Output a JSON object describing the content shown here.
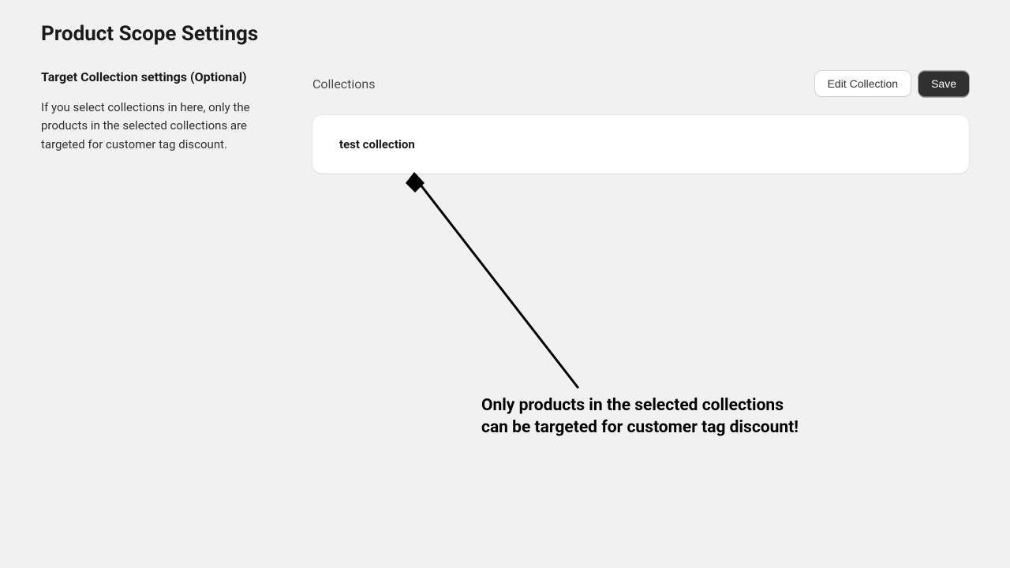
{
  "page": {
    "title": "Product Scope Settings"
  },
  "sidebar": {
    "section_title": "Target Collection settings (Optional)",
    "section_desc": "If you select collections in here, only the products in the selected collections are targeted for customer tag discount."
  },
  "main": {
    "label": "Collections",
    "edit_button": "Edit Collection",
    "save_button": "Save",
    "items": [
      {
        "name": "test collection"
      }
    ]
  },
  "annotation": {
    "text": "Only products in the selected collections\ncan be targeted for customer tag discount!"
  }
}
